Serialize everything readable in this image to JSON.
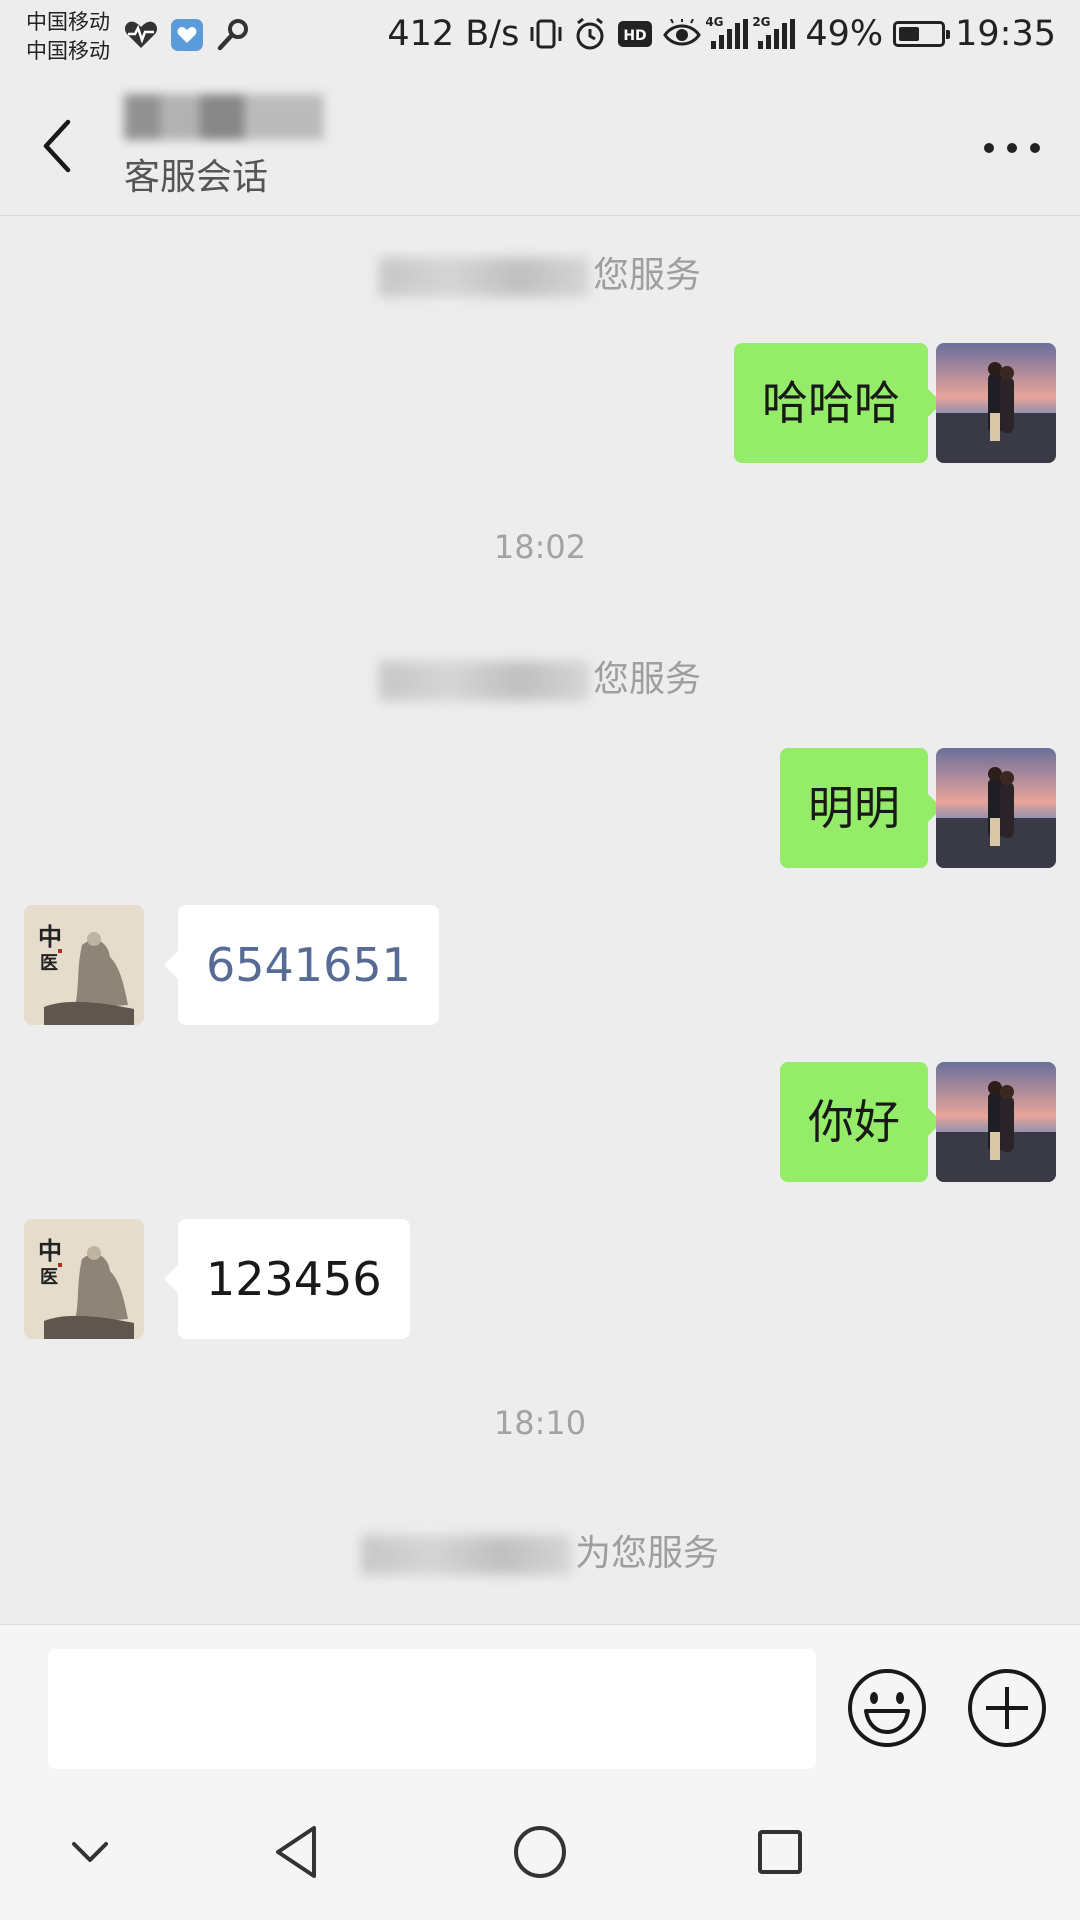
{
  "status_bar": {
    "carrier_1": "中国移动",
    "carrier_2": "中国移动",
    "network_speed": "412 B/s",
    "network_1_type": "4G",
    "network_2_type": "2G",
    "battery": "49%",
    "battery_level": 0.49,
    "time": "19:35"
  },
  "header": {
    "subtitle": "客服会话",
    "more_label": "more"
  },
  "messages": {
    "sys_1_suffix": "您服务",
    "msg_1": "哈哈哈",
    "time_1": "18:02",
    "sys_2_suffix": "您服务",
    "msg_2": "明明",
    "reply_1": "6541651",
    "msg_3": "你好",
    "reply_2": "123456",
    "time_2": "18:10",
    "sys_3_suffix": "为您服务"
  },
  "input": {
    "value": "",
    "placeholder": ""
  },
  "colors": {
    "background": "#ededed",
    "outgoing_bubble": "#95ec69",
    "incoming_bubble": "#ffffff",
    "link_text": "#576b95"
  },
  "icons": {
    "back": "chevron-left-icon",
    "more": "ellipsis-icon",
    "emoji": "smiley-icon",
    "plus": "plus-circle-icon"
  }
}
